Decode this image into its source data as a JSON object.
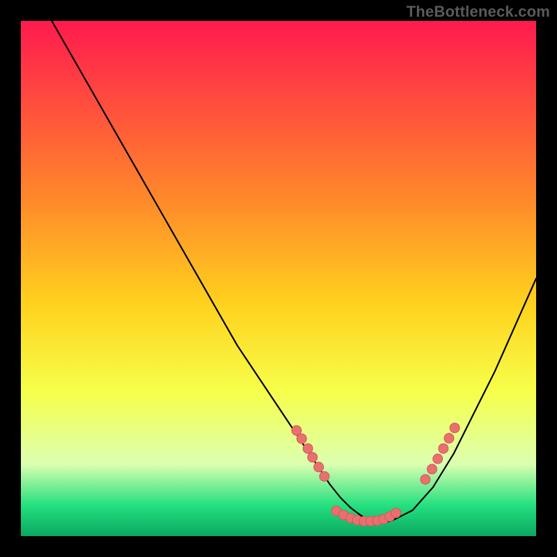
{
  "watermark": "TheBottleneck.com",
  "colors": {
    "background": "#000000",
    "curve": "#000000",
    "dot_fill": "#e9706e",
    "dot_stroke": "#cf5a58",
    "grad_top": "#ff1a4e",
    "grad_mid1": "#ff8a2a",
    "grad_mid2": "#ffd21e",
    "grad_mid3": "#f6ff4a",
    "grad_bottom_pale": "#dcffb0",
    "grad_green": "#24e07f",
    "grad_green_dark": "#0aa861"
  },
  "chart_data": {
    "type": "line",
    "title": "",
    "xlabel": "",
    "ylabel": "",
    "xlim": [
      0,
      100
    ],
    "ylim": [
      0,
      100
    ],
    "curve": {
      "name": "bottleneck-curve",
      "x": [
        6,
        10,
        14,
        18,
        22,
        26,
        30,
        34,
        38,
        42,
        46,
        50,
        54,
        56,
        58,
        60,
        62,
        64,
        66,
        68,
        70,
        72,
        76,
        80,
        84,
        88,
        92,
        96,
        100
      ],
      "y": [
        100,
        93,
        86,
        79,
        72,
        65,
        58,
        51,
        44,
        37,
        31,
        25,
        19,
        16,
        13,
        10,
        7.5,
        5.5,
        4,
        3,
        2.5,
        3,
        5,
        9.5,
        16,
        24,
        32,
        41,
        50
      ]
    },
    "series": [
      {
        "name": "left-cluster-dots",
        "x": [
          53.5,
          54.5,
          55.7,
          56.6,
          57.8,
          58.9
        ],
        "y": [
          20.5,
          18.9,
          17.0,
          15.3,
          13.4,
          11.6
        ]
      },
      {
        "name": "bottom-cluster-dots",
        "x": [
          61.2,
          62.6,
          64.0,
          65.3,
          66.6,
          67.9,
          69.2,
          70.4,
          71.6,
          72.8
        ],
        "y": [
          4.9,
          4.1,
          3.5,
          3.1,
          2.9,
          2.9,
          3.0,
          3.3,
          3.8,
          4.5
        ]
      },
      {
        "name": "right-cluster-dots",
        "x": [
          78.5,
          79.8,
          80.9,
          82.0,
          83.1,
          84.2
        ],
        "y": [
          11.0,
          13.0,
          15.0,
          17.0,
          19.0,
          21.0
        ]
      }
    ]
  }
}
